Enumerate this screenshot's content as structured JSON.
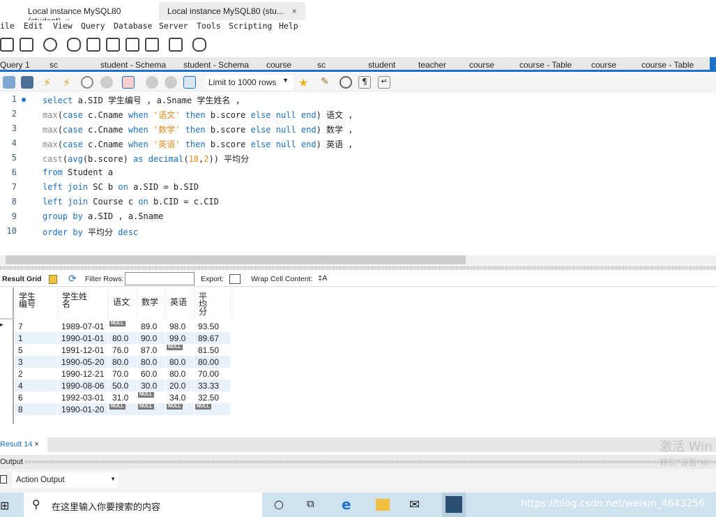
{
  "window_tabs": [
    {
      "label": "Local instance MySQL80 (student)",
      "close": "×"
    },
    {
      "label": "Local instance MySQL80 (stu...",
      "close": "×"
    }
  ],
  "menu": [
    "ile",
    "Edit",
    "View",
    "Query",
    "Database",
    "Server",
    "Tools",
    "Scripting",
    "Help"
  ],
  "query_tabs": [
    "Query 1",
    "sc",
    "student - Schema",
    "student - Schema",
    "course",
    "sc",
    "student",
    "teacher",
    "course",
    "course - Table",
    "course",
    "course - Table",
    "c"
  ],
  "editor_toolbar": {
    "limit": "Limit to 1000 rows"
  },
  "sql_lines": [
    [
      [
        "kw",
        "select"
      ],
      [
        "pl",
        " a.SID 学生编号 , a.Sname 学生姓名 ,"
      ]
    ],
    [
      [
        "fn",
        "max"
      ],
      [
        "pl",
        "("
      ],
      [
        "kw",
        "case"
      ],
      [
        "pl",
        " c.Cname "
      ],
      [
        "kw",
        "when"
      ],
      [
        "pl",
        " "
      ],
      [
        "str",
        "'语文'"
      ],
      [
        "pl",
        " "
      ],
      [
        "kw",
        "then"
      ],
      [
        "pl",
        " b.score "
      ],
      [
        "kw",
        "else"
      ],
      [
        "pl",
        " "
      ],
      [
        "kw",
        "null"
      ],
      [
        "pl",
        " "
      ],
      [
        "kw",
        "end"
      ],
      [
        "pl",
        ") 语文 ,"
      ]
    ],
    [
      [
        "fn",
        "max"
      ],
      [
        "pl",
        "("
      ],
      [
        "kw",
        "case"
      ],
      [
        "pl",
        " c.Cname "
      ],
      [
        "kw",
        "when"
      ],
      [
        "pl",
        " "
      ],
      [
        "str",
        "'数学'"
      ],
      [
        "pl",
        " "
      ],
      [
        "kw",
        "then"
      ],
      [
        "pl",
        " b.score "
      ],
      [
        "kw",
        "else"
      ],
      [
        "pl",
        " "
      ],
      [
        "kw",
        "null"
      ],
      [
        "pl",
        " "
      ],
      [
        "kw",
        "end"
      ],
      [
        "pl",
        ") 数学 ,"
      ]
    ],
    [
      [
        "fn",
        "max"
      ],
      [
        "pl",
        "("
      ],
      [
        "kw",
        "case"
      ],
      [
        "pl",
        " c.Cname "
      ],
      [
        "kw",
        "when"
      ],
      [
        "pl",
        " "
      ],
      [
        "str",
        "'英语'"
      ],
      [
        "pl",
        " "
      ],
      [
        "kw",
        "then"
      ],
      [
        "pl",
        " b.score "
      ],
      [
        "kw",
        "else"
      ],
      [
        "pl",
        " "
      ],
      [
        "kw",
        "null"
      ],
      [
        "pl",
        " "
      ],
      [
        "kw",
        "end"
      ],
      [
        "pl",
        ") 英语 ,"
      ]
    ],
    [
      [
        "fn",
        "cast"
      ],
      [
        "pl",
        "("
      ],
      [
        "kw",
        "avg"
      ],
      [
        "pl",
        "(b.score) "
      ],
      [
        "kw",
        "as"
      ],
      [
        "pl",
        " "
      ],
      [
        "kw",
        "decimal"
      ],
      [
        "pl",
        "("
      ],
      [
        "num",
        "18"
      ],
      [
        "pl",
        ","
      ],
      [
        "num",
        "2"
      ],
      [
        "pl",
        ")) 平均分"
      ]
    ],
    [
      [
        "kw",
        "from"
      ],
      [
        "pl",
        " Student a"
      ]
    ],
    [
      [
        "kw",
        "left join"
      ],
      [
        "pl",
        " SC b "
      ],
      [
        "kw",
        "on"
      ],
      [
        "pl",
        " a.SID = b.SID"
      ]
    ],
    [
      [
        "kw",
        "left join"
      ],
      [
        "pl",
        " Course c "
      ],
      [
        "kw",
        "on"
      ],
      [
        "pl",
        " b.CID = c.CID"
      ]
    ],
    [
      [
        "kw",
        "group by"
      ],
      [
        "pl",
        " a.SID , a.Sname"
      ]
    ],
    [
      [
        "kw",
        "order by"
      ],
      [
        "pl",
        " 平均分 "
      ],
      [
        "kw",
        "desc"
      ]
    ]
  ],
  "result_toolbar": {
    "grid": "Result Grid",
    "filter": "Filter Rows:",
    "export": "Export:",
    "wrap": "Wrap Cell Content:"
  },
  "grid": {
    "columns": [
      "学生\n编号",
      "学生姓\n名",
      "语文",
      "数学",
      "英语",
      "平\n均\n分"
    ],
    "null_label": "NULL",
    "rows": [
      [
        "7",
        "1989-07-01",
        null,
        "89.0",
        "98.0",
        "93.50"
      ],
      [
        "1",
        "1990-01-01",
        "80.0",
        "90.0",
        "99.0",
        "89.67"
      ],
      [
        "5",
        "1991-12-01",
        "76.0",
        "87.0",
        null,
        "81.50"
      ],
      [
        "3",
        "1990-05-20",
        "80.0",
        "80.0",
        "80.0",
        "80.00"
      ],
      [
        "2",
        "1990-12-21",
        "70.0",
        "60.0",
        "80.0",
        "70.00"
      ],
      [
        "4",
        "1990-08-06",
        "50.0",
        "30.0",
        "20.0",
        "33.33"
      ],
      [
        "6",
        "1992-03-01",
        "31.0",
        null,
        "34.0",
        "32.50"
      ],
      [
        "8",
        "1990-01-20",
        null,
        null,
        null,
        null
      ]
    ]
  },
  "result_tab": {
    "label": "Result 14",
    "close": "×"
  },
  "output": {
    "label": "Output",
    "select": "Action Output"
  },
  "taskbar": {
    "search_placeholder": "在这里输入你要搜索的内容",
    "url_watermark": "https://blog.csdn.net/weixin_4643256"
  },
  "activation": {
    "line1": "激活 Win",
    "line2": "转到\"设置\"以"
  }
}
